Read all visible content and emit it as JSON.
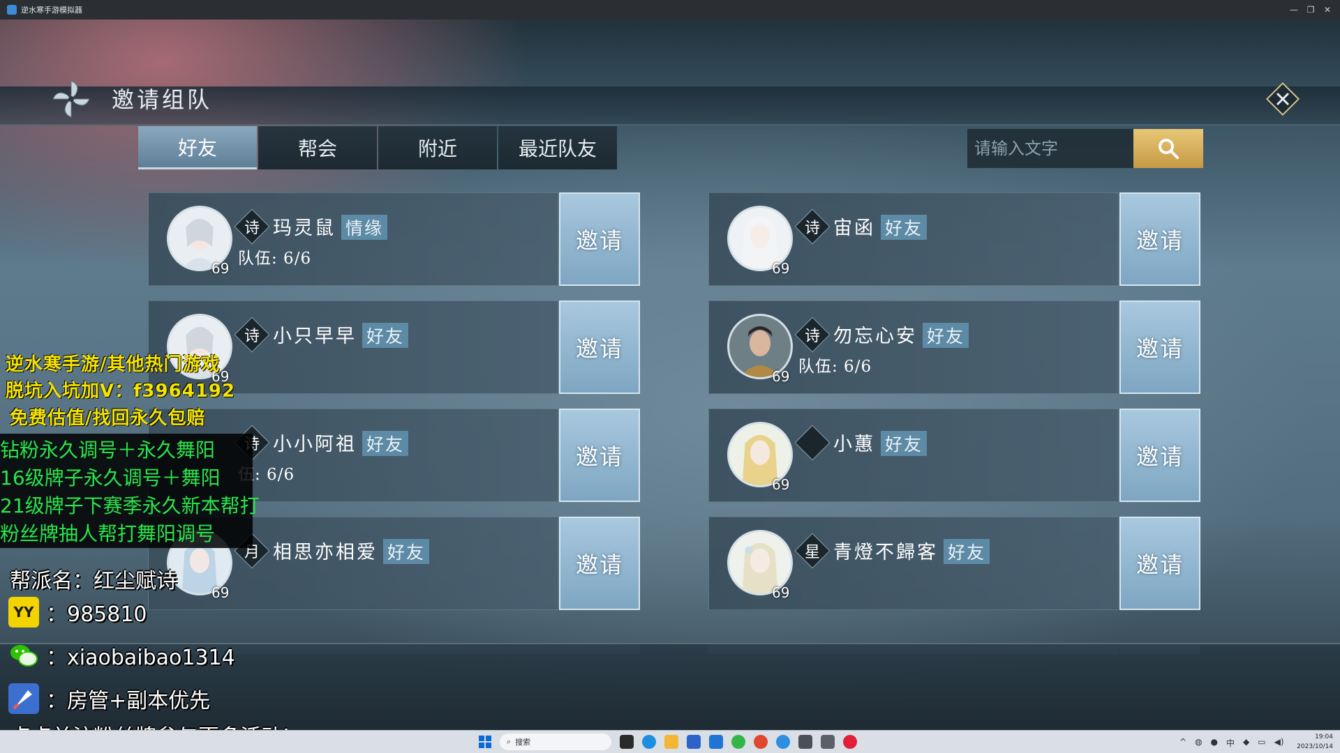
{
  "window": {
    "title": "逆水寒手游模拟器",
    "controls": [
      "—",
      "❐",
      "✕"
    ]
  },
  "dialog": {
    "title": "邀请组队"
  },
  "tabs": [
    {
      "label": "好友",
      "active": true
    },
    {
      "label": "帮会",
      "active": false
    },
    {
      "label": "附近",
      "active": false
    },
    {
      "label": "最近队友",
      "active": false
    }
  ],
  "search": {
    "placeholder": "请输入文字"
  },
  "invite_label": "邀请",
  "friends": [
    {
      "sect": "诗",
      "name": "玛灵鼠",
      "tag": "情缘",
      "team": "队伍: 6/6",
      "level": "69"
    },
    {
      "sect": "诗",
      "name": "宙函",
      "tag": "好友",
      "team": "",
      "level": "69"
    },
    {
      "sect": "诗",
      "name": "小只早早",
      "tag": "好友",
      "team": "",
      "level": "69"
    },
    {
      "sect": "诗",
      "name": "勿忘心安",
      "tag": "好友",
      "team": "队伍: 6/6",
      "level": "69"
    },
    {
      "sect": "诗",
      "name": "小小阿祖",
      "tag": "好友",
      "team": "伍: 6/6",
      "level": "69"
    },
    {
      "sect": "",
      "name": "小蕙",
      "tag": "好友",
      "team": "",
      "level": "69"
    },
    {
      "sect": "月",
      "name": "相思亦相爱",
      "tag": "好友",
      "team": "",
      "level": "69"
    },
    {
      "sect": "星",
      "name": "青燈不歸客",
      "tag": "好友",
      "team": "",
      "level": "69"
    }
  ],
  "overlay": {
    "promo": [
      "逆水寒手游/其他热门游戏",
      "脱坑入坑加V：f3964192",
      "免费估值/找回永久包赔"
    ],
    "green": [
      "钻粉永久调号＋永久舞阳",
      "16级牌子永久调号＋舞阳",
      "21级牌子下赛季永久新本帮打",
      "粉丝牌抽人帮打舞阳调号"
    ],
    "guild": "帮派名：红尘赋诗",
    "yy": "：985810",
    "wechat": "：xiaobaibao1314",
    "perk": "：房管+副本优先",
    "follow": "点点关注粉丝牌参与更多活动!"
  },
  "taskbar": {
    "search": "搜索",
    "time": "19:04",
    "date": "2023/10/14"
  },
  "colors": {
    "tab_active": "#7d9cb3",
    "tag_bg": "#5d8aa5",
    "invite_btn": "#93b8d1",
    "search_btn": "#d9b560",
    "promo_text": "#f5e400",
    "green_text": "#28e64b"
  }
}
